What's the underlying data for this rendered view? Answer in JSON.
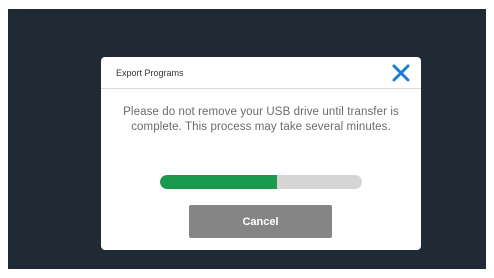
{
  "dialog": {
    "title": "Export Programs",
    "close_icon": "close-x-icon",
    "message": "Please do not remove your USB drive until transfer is complete. This process may take several minutes.",
    "progress_fraction": 0.58,
    "cancel_label": "Cancel"
  },
  "colors": {
    "screen_background": "#1f2a34",
    "close_icon": "#1a7fd4",
    "progress_fill": "#1a9a4f",
    "progress_track": "#d5d5d5",
    "cancel_button": "#858585"
  }
}
